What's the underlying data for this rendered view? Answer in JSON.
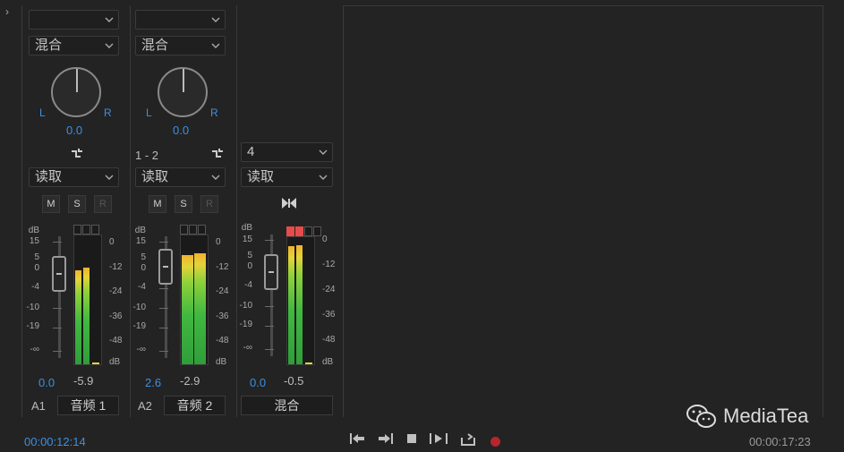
{
  "tracks": [
    {
      "id": "A1",
      "name": "音频 1",
      "mode": "混合",
      "top_selector": "",
      "pan": "0.0",
      "pan_left": "L",
      "pan_right": "R",
      "route": "",
      "automation": "读取",
      "m": "M",
      "s": "S",
      "r": "R",
      "volume": "0.0",
      "peak": "-5.9",
      "meter_level_left": 0.73,
      "meter_level_right": 0.75
    },
    {
      "id": "A2",
      "name": "音频 2",
      "mode": "混合",
      "top_selector": "",
      "pan": "0.0",
      "pan_left": "L",
      "pan_right": "R",
      "route": "1 - 2",
      "automation": "读取",
      "m": "M",
      "s": "S",
      "r": "R",
      "volume": "2.6",
      "peak": "-2.9",
      "meter_level_left": 0.85,
      "meter_level_right": 0.86
    }
  ],
  "master": {
    "name": "混合",
    "channel_select": "4",
    "automation": "读取",
    "volume": "0.0",
    "peak": "-0.5",
    "meter_level_left": 0.93,
    "meter_level_right": 0.94
  },
  "scale_left": [
    "dB",
    "15",
    "5",
    "0",
    "-4",
    "-10",
    "-19",
    "-∞"
  ],
  "scale_right": [
    "0",
    "-12",
    "-24",
    "-36",
    "-48",
    "dB"
  ],
  "footer": {
    "time_left": "00:00:12:14",
    "time_right": "00:00:17:23"
  },
  "watermark": "MediaTea",
  "colors": {
    "accent_blue": "#3d8fe0",
    "record_red": "#b6262a"
  }
}
